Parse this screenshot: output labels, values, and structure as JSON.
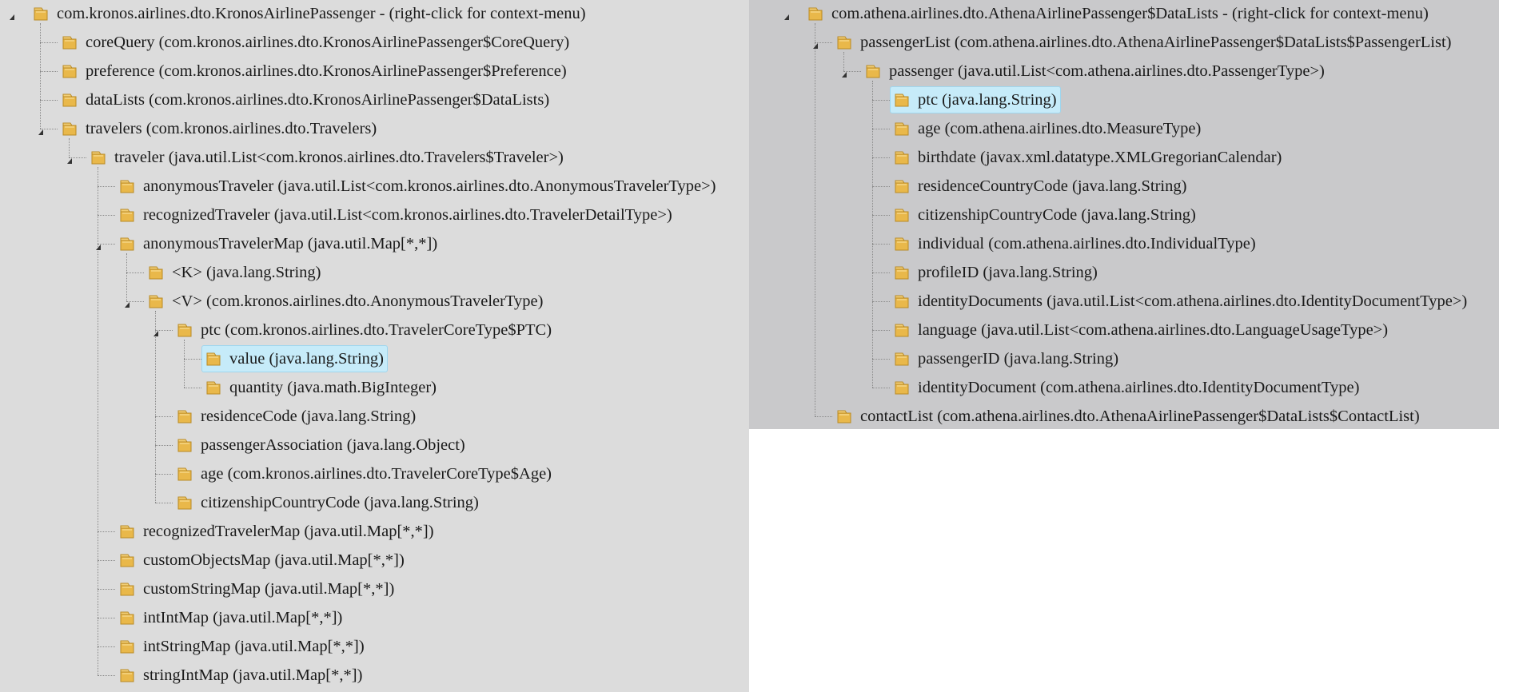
{
  "left_tree": {
    "nodes": [
      {
        "text": "com.kronos.airlines.dto.KronosAirlinePassenger - (right-click for context-menu)",
        "depth": 0,
        "expanded": true
      },
      {
        "text": "coreQuery (com.kronos.airlines.dto.KronosAirlinePassenger$CoreQuery)",
        "depth": 1
      },
      {
        "text": "preference (com.kronos.airlines.dto.KronosAirlinePassenger$Preference)",
        "depth": 1
      },
      {
        "text": "dataLists (com.kronos.airlines.dto.KronosAirlinePassenger$DataLists)",
        "depth": 1
      },
      {
        "text": "travelers (com.kronos.airlines.dto.Travelers)",
        "depth": 1,
        "expanded": true
      },
      {
        "text": "traveler (java.util.List<com.kronos.airlines.dto.Travelers$Traveler>)",
        "depth": 2,
        "expanded": true
      },
      {
        "text": "anonymousTraveler (java.util.List<com.kronos.airlines.dto.AnonymousTravelerType>)",
        "depth": 3
      },
      {
        "text": "recognizedTraveler (java.util.List<com.kronos.airlines.dto.TravelerDetailType>)",
        "depth": 3
      },
      {
        "text": "anonymousTravelerMap (java.util.Map[*,*])",
        "depth": 3,
        "expanded": true
      },
      {
        "text": "<K> (java.lang.String)",
        "depth": 4
      },
      {
        "text": "<V> (com.kronos.airlines.dto.AnonymousTravelerType)",
        "depth": 4,
        "expanded": true
      },
      {
        "text": "ptc (com.kronos.airlines.dto.TravelerCoreType$PTC)",
        "depth": 5,
        "expanded": true
      },
      {
        "text": "value (java.lang.String)",
        "depth": 6,
        "selected": true
      },
      {
        "text": "quantity (java.math.BigInteger)",
        "depth": 6
      },
      {
        "text": "residenceCode (java.lang.String)",
        "depth": 5
      },
      {
        "text": "passengerAssociation (java.lang.Object)",
        "depth": 5
      },
      {
        "text": "age (com.kronos.airlines.dto.TravelerCoreType$Age)",
        "depth": 5
      },
      {
        "text": "citizenshipCountryCode (java.lang.String)",
        "depth": 5
      },
      {
        "text": "recognizedTravelerMap (java.util.Map[*,*])",
        "depth": 3
      },
      {
        "text": "customObjectsMap (java.util.Map[*,*])",
        "depth": 3
      },
      {
        "text": "customStringMap (java.util.Map[*,*])",
        "depth": 3
      },
      {
        "text": "intIntMap (java.util.Map[*,*])",
        "depth": 3
      },
      {
        "text": "intStringMap (java.util.Map[*,*])",
        "depth": 3
      },
      {
        "text": "stringIntMap (java.util.Map[*,*])",
        "depth": 3
      }
    ]
  },
  "right_tree": {
    "nodes": [
      {
        "text": "com.athena.airlines.dto.AthenaAirlinePassenger$DataLists - (right-click for context-menu)",
        "depth": 0,
        "expanded": true
      },
      {
        "text": "passengerList (com.athena.airlines.dto.AthenaAirlinePassenger$DataLists$PassengerList)",
        "depth": 1,
        "expanded": true
      },
      {
        "text": "passenger (java.util.List<com.athena.airlines.dto.PassengerType>)",
        "depth": 2,
        "expanded": true
      },
      {
        "text": "ptc (java.lang.String)",
        "depth": 3,
        "selected": true
      },
      {
        "text": "age (com.athena.airlines.dto.MeasureType)",
        "depth": 3
      },
      {
        "text": "birthdate (javax.xml.datatype.XMLGregorianCalendar)",
        "depth": 3
      },
      {
        "text": "residenceCountryCode (java.lang.String)",
        "depth": 3
      },
      {
        "text": "citizenshipCountryCode (java.lang.String)",
        "depth": 3
      },
      {
        "text": "individual (com.athena.airlines.dto.IndividualType)",
        "depth": 3
      },
      {
        "text": "profileID (java.lang.String)",
        "depth": 3
      },
      {
        "text": "identityDocuments (java.util.List<com.athena.airlines.dto.IdentityDocumentType>)",
        "depth": 3
      },
      {
        "text": "language (java.util.List<com.athena.airlines.dto.LanguageUsageType>)",
        "depth": 3
      },
      {
        "text": "passengerID (java.lang.String)",
        "depth": 3
      },
      {
        "text": "identityDocument (com.athena.airlines.dto.IdentityDocumentType)",
        "depth": 3
      },
      {
        "text": "contactList (com.athena.airlines.dto.AthenaAirlinePassenger$DataLists$ContactList)",
        "depth": 1
      }
    ]
  },
  "icon": "folder-icon",
  "colors": {
    "left_bg": "#dcdcdc",
    "right_bg": "#c9c9cb",
    "selection_bg": "#c6ebf9",
    "folder": "#e9b84a"
  }
}
